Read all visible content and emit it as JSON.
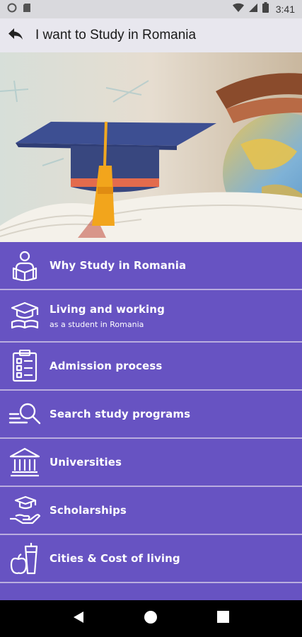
{
  "status_bar": {
    "time": "3:41"
  },
  "app_bar": {
    "title": "I want to Study in Romania"
  },
  "menu": {
    "items": [
      {
        "label": "Why Study in Romania",
        "sub": ""
      },
      {
        "label": "Living and working",
        "sub": "as a student in Romania"
      },
      {
        "label": "Admission process",
        "sub": ""
      },
      {
        "label": "Search study programs",
        "sub": ""
      },
      {
        "label": "Universities",
        "sub": ""
      },
      {
        "label": "Scholarships",
        "sub": ""
      },
      {
        "label": "Cities & Cost of living",
        "sub": ""
      }
    ]
  },
  "colors": {
    "menu_bg": "#6753c2",
    "divider": "#b9addf",
    "app_bar": "#e8e7ee",
    "status_bar": "#d9d9dd"
  }
}
